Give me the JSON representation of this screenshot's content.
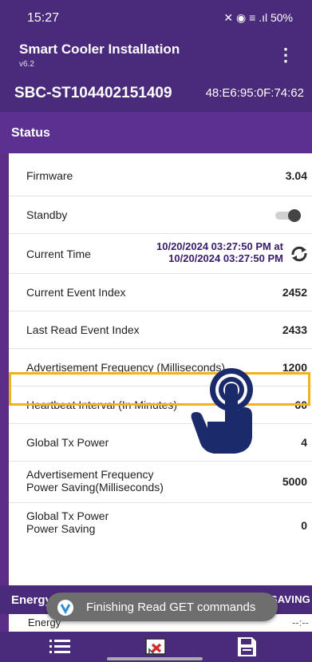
{
  "status_bar": {
    "time": "15:27",
    "indicators": "✕ ◉ ≡ .ıl 50%"
  },
  "app": {
    "title": "Smart Cooler Installation",
    "version": "v6.2",
    "menu_icon": "more-vert-icon"
  },
  "device": {
    "id": "SBC-ST104402151409",
    "mac": "48:E6:95:0F:74:62"
  },
  "status_section": {
    "title": "Status",
    "rows": {
      "firmware": {
        "label": "Firmware",
        "value": "3.04"
      },
      "standby": {
        "label": "Standby",
        "toggle_on": false
      },
      "current_time": {
        "label": "Current Time",
        "line1": "10/20/2024 03:27:50 PM at",
        "line2": "10/20/2024 03:27:50 PM"
      },
      "current_event_index": {
        "label": "Current Event Index",
        "value": "2452"
      },
      "last_read_event_index": {
        "label": "Last Read Event Index",
        "value": "2433"
      },
      "advertisement_frequency": {
        "label": "Advertisement Frequency (Milliseconds)",
        "value": "1200"
      },
      "heartbeat_interval": {
        "label": "Heartbeat Interval (In Minutes)",
        "value": "60"
      },
      "global_tx_power": {
        "label": "Global Tx Power",
        "value": "4"
      },
      "adv_freq_power_saving": {
        "label_line1": "Advertisement Frequency",
        "label_line2": "Power Saving(Milliseconds)",
        "value": "5000"
      },
      "global_tx_power_saving": {
        "label_line1": "Global Tx Power",
        "label_line2": "Power Saving",
        "value": "0"
      }
    }
  },
  "energy_section": {
    "title": "Energy",
    "button": "DISABLE ENERGY SAVING",
    "row_label": "Energy",
    "row_value": "--:--"
  },
  "toast": {
    "text": "Finishing Read GET commands"
  },
  "bottom_nav": [
    "menu-list-icon",
    "cast-off-icon",
    "save-icon"
  ],
  "colors": {
    "primary": "#4a2a7a",
    "section": "#5b3090",
    "highlight": "#f2b21b",
    "time_text": "#3a1c6e",
    "pointer": "#1b2a6b"
  }
}
